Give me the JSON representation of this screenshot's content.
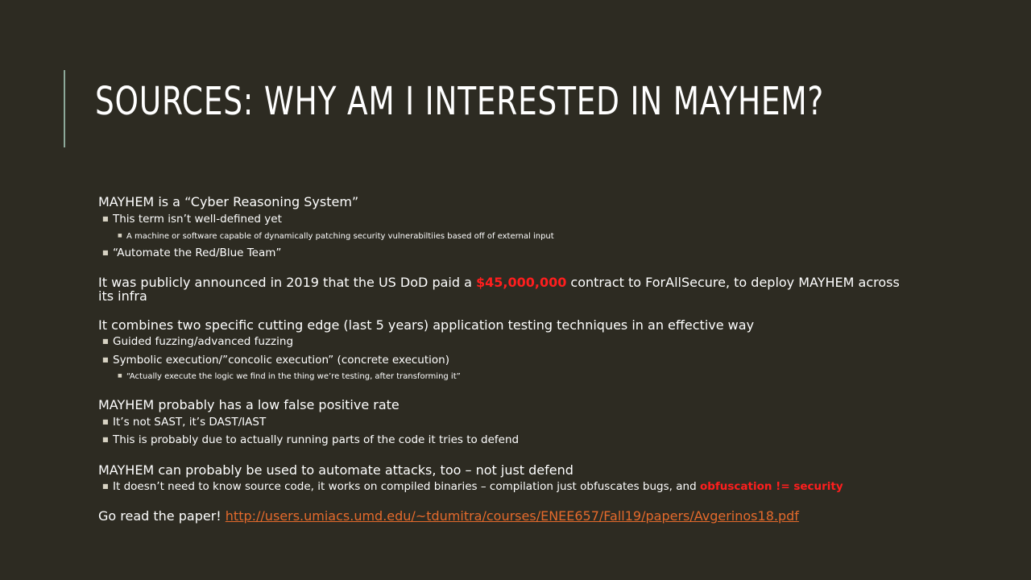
{
  "slide": {
    "title": "SOURCES: WHY AM I INTERESTED IN MAYHEM?",
    "accent_color": "#8da99a",
    "background_color": "#2d2b22"
  },
  "content": {
    "p1": "MAYHEM is a “Cyber Reasoning System”",
    "p1_b1": "This term isn’t well-defined  yet",
    "p1_b1_sub": "A machine or software capable of dynamically patching security vulnerabiltiies based off of external input",
    "p1_b2": "“Automate the Red/Blue Team”",
    "p2_pre": "It was publicly announced in 2019 that the US DoD paid a ",
    "p2_amount": "$45,000,000",
    "p2_post": " contract to ForAllSecure, to deploy MAYHEM across its infra",
    "p3": "It combines two specific cutting edge (last 5 years) application testing techniques in an effective way",
    "p3_b1": "Guided fuzzing/advanced  fuzzing",
    "p3_b2": "Symbolic execution/”concolic execution” (concrete execution)",
    "p3_b2_sub": "“Actually execute the logic we find in the thing we’re testing, after transforming it”",
    "p4": "MAYHEM probably has a low false positive rate",
    "p4_b1": "It’s not SAST, it’s DAST/IAST",
    "p4_b2": "This is probably due to actually running  parts of the code it tries to defend",
    "p5": "MAYHEM can probably be used to automate attacks, too – not just defend",
    "p5_b1_pre": "It doesn’t need to know source code, it works on compiled binaries – compilation  just obfuscates bugs, and ",
    "p5_b1_red": "obfuscation  != security",
    "p6_pre": "Go read the paper! ",
    "p6_link": "http://users.umiacs.umd.edu/~tdumitra/courses/ENEE657/Fall19/papers/Avgerinos18.pdf"
  },
  "colors": {
    "highlight_red": "#ff1e1e",
    "link": "#e46a2c"
  }
}
